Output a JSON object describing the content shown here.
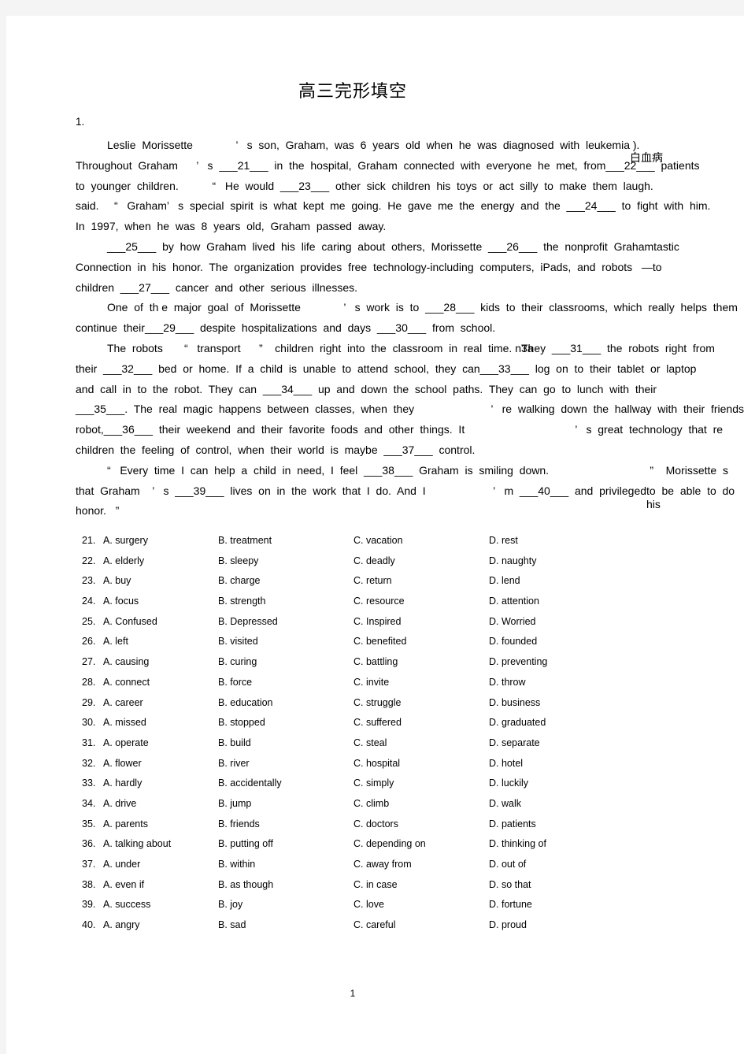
{
  "document": {
    "title": "高三完形填空",
    "question_number": "1.",
    "page_number": "1"
  },
  "passage": {
    "paragraphs": [
      {
        "lines": [
          {
            "indent": true,
            "text": "Leslie  Morissette              ’   s  son,  Graham,  was  6  years  old  when  he  was  diagnosed  with  leukemia",
            "overlap": {
              "base": "leukemia",
              "over": "白血病",
              "after": " )."
            }
          },
          {
            "indent": false,
            "text": "Throughout  Graham      ’   s  ___21___  in  the  hospital,  Graham  connected  with  everyone  he  met,  from___22___  patients"
          },
          {
            "indent": false,
            "text": "to  younger  children.           “   He  would  ___23___  other  sick  children  his  toys  or  act  silly  to  make  them  laugh."
          },
          {
            "indent": false,
            "text": "said.     “   Graham’   s  special  spirit  is  what  kept  me  going.  He  gave  me  the  energy  and  the  ___24___  to  fight  with  him."
          },
          {
            "indent": false,
            "text": "In  1997,  when  he  was  8  years  old,  Graham  passed  away."
          }
        ]
      },
      {
        "lines": [
          {
            "indent": true,
            "text": "___25___  by  how  Graham  lived  his  life  caring  about  others,  Morissette  ___26___  the  nonprofit  Grahamtastic"
          },
          {
            "indent": false,
            "text": "Connection  in  his  honor.  The  organization  provides  free  technology-including  computers,  iPads,  and  robots   —to"
          },
          {
            "indent": false,
            "text": "children  ___27___  cancer  and  other  serious  illnesses."
          }
        ]
      },
      {
        "lines": [
          {
            "indent": true,
            "text": "One  of  th e  major  goal  of  Morissette              ’   s  work  is  to  ___28___  kids  to  their  classrooms,  which  really  helps  them"
          },
          {
            "indent": false,
            "text": "continue  their___29___  despite  hospitalizations  and  days  ___30___  from  school."
          }
        ]
      },
      {
        "lines": [
          {
            "indent": true,
            "text": "The  robots       “   transport      ”    children  right  into  the  classroom  in  real  time. n",
            "overlap2": {
              "base": "They  ___31___",
              "over": "3a",
              "after": "  the  robots  right  from"
            }
          },
          {
            "indent": false,
            "text": "their  ___32___  bed  or  home.  If  a  child  is  unable  to  attend  school,  they  can___33___  log  on  to  their  tablet  or  laptop"
          },
          {
            "indent": false,
            "text": "and  call  in  to  the  robot.  They  can  ___34___  up  and  down  the  school  paths.  They  can  go  to  lunch  with  their"
          },
          {
            "indent": false,
            "text": "___35___.  The  real  magic  happens  between  classes,  when  they                         ’   re  walking  down  the  hallway  with  their  friends,"
          },
          {
            "indent": false,
            "text": "robot,___36___  their  weekend  and  their  favorite  foods  and  other  things.  It                                    ’   s  great  technology  that  re"
          },
          {
            "indent": false,
            "text": "children  the  feeling  of  control,  when  their  world  is  maybe  ___37___  control."
          }
        ]
      },
      {
        "lines": [
          {
            "indent": true,
            "text": "“   Every  time  I  can  help  a  child  in  need,  I  feel  ___38___  Graham  is  smiling  down.                                 ”    Morissette  s"
          },
          {
            "indent": false,
            "text": "that  Graham    ’   s  ___39___  lives  on  in  the  work  that  I  do.  And  I                      ’   m  ___40___  and  privileged",
            "overlap3": {
              "base": "privileged",
              "over": "his ",
              "after": "to  be  able  to  do"
            }
          },
          {
            "indent": false,
            "text": "honor.   ”"
          }
        ]
      }
    ]
  },
  "options": {
    "columns": [
      "A",
      "B",
      "C",
      "D"
    ],
    "rows": [
      {
        "num": "21.",
        "a": "A.  surgery",
        "b": "B.  treatment",
        "c": "C.  vacation",
        "d": "D.  rest"
      },
      {
        "num": "22.",
        "a": "A.  elderly",
        "b": "B.  sleepy",
        "c": "C.  deadly",
        "d": "D.  naughty"
      },
      {
        "num": "23.",
        "a": "A.  buy",
        "b": "B.  charge",
        "c": "C.  return",
        "d": "D.  lend"
      },
      {
        "num": "24.",
        "a": "A.  focus",
        "b": "B.  strength",
        "c": "C.  resource",
        "d": "D.  attention"
      },
      {
        "num": "25.",
        "a": "A.  Confused",
        "b": "B.  Depressed",
        "c": "C.  Inspired",
        "d": "D.  Worried"
      },
      {
        "num": "26.",
        "a": "A.  left",
        "b": "B.  visited",
        "c": "C.  benefited",
        "d": "D.  founded"
      },
      {
        "num": "27.",
        "a": "A.  causing",
        "b": "B.  curing",
        "c": "C.  battling",
        "d": "D.  preventing"
      },
      {
        "num": "28.",
        "a": "A.  connect",
        "b": "B.  force",
        "c": "C.  invite",
        "d": "D.  throw"
      },
      {
        "num": "29.",
        "a": "A.  career",
        "b": "B.  education",
        "c": "C.  struggle",
        "d": "D.  business"
      },
      {
        "num": "30.",
        "a": "A.  missed",
        "b": "B.  stopped",
        "c": "C.  suffered",
        "d": "D.  graduated"
      },
      {
        "num": "31.",
        "a": "A.  operate",
        "b": "B.  build",
        "c": "C.  steal",
        "d": "D.  separate"
      },
      {
        "num": "32.",
        "a": "A.  flower",
        "b": "B.  river",
        "c": "C.  hospital",
        "d": "D.  hotel"
      },
      {
        "num": "33.",
        "a": "A.  hardly",
        "b": "B.  accidentally",
        "c": "C.  simply",
        "d": "D.  luckily"
      },
      {
        "num": "34.",
        "a": "A.  drive",
        "b": "B.  jump",
        "c": "C.  climb",
        "d": "D.  walk"
      },
      {
        "num": "35.",
        "a": "A.  parents",
        "b": "B.  friends",
        "c": "C.  doctors",
        "d": "D.  patients"
      },
      {
        "num": "36.",
        "a": "A.  talking about",
        "b": "B.  putting off",
        "c": "C.  depending on",
        "d": "D.  thinking of"
      },
      {
        "num": "37.",
        "a": "A.  under",
        "b": "B.  within",
        "c": "C.  away from",
        "d": "D.  out of"
      },
      {
        "num": "38.",
        "a": "A.  even if",
        "b": "B.  as though",
        "c": "C.  in case",
        "d": "D.  so that"
      },
      {
        "num": "39.",
        "a": "A.  success",
        "b": "B.  joy",
        "c": "C.  love",
        "d": "D.  fortune"
      },
      {
        "num": "40.",
        "a": "A.  angry",
        "b": "B.  sad",
        "c": "C.  careful",
        "d": "D.  proud"
      }
    ]
  }
}
